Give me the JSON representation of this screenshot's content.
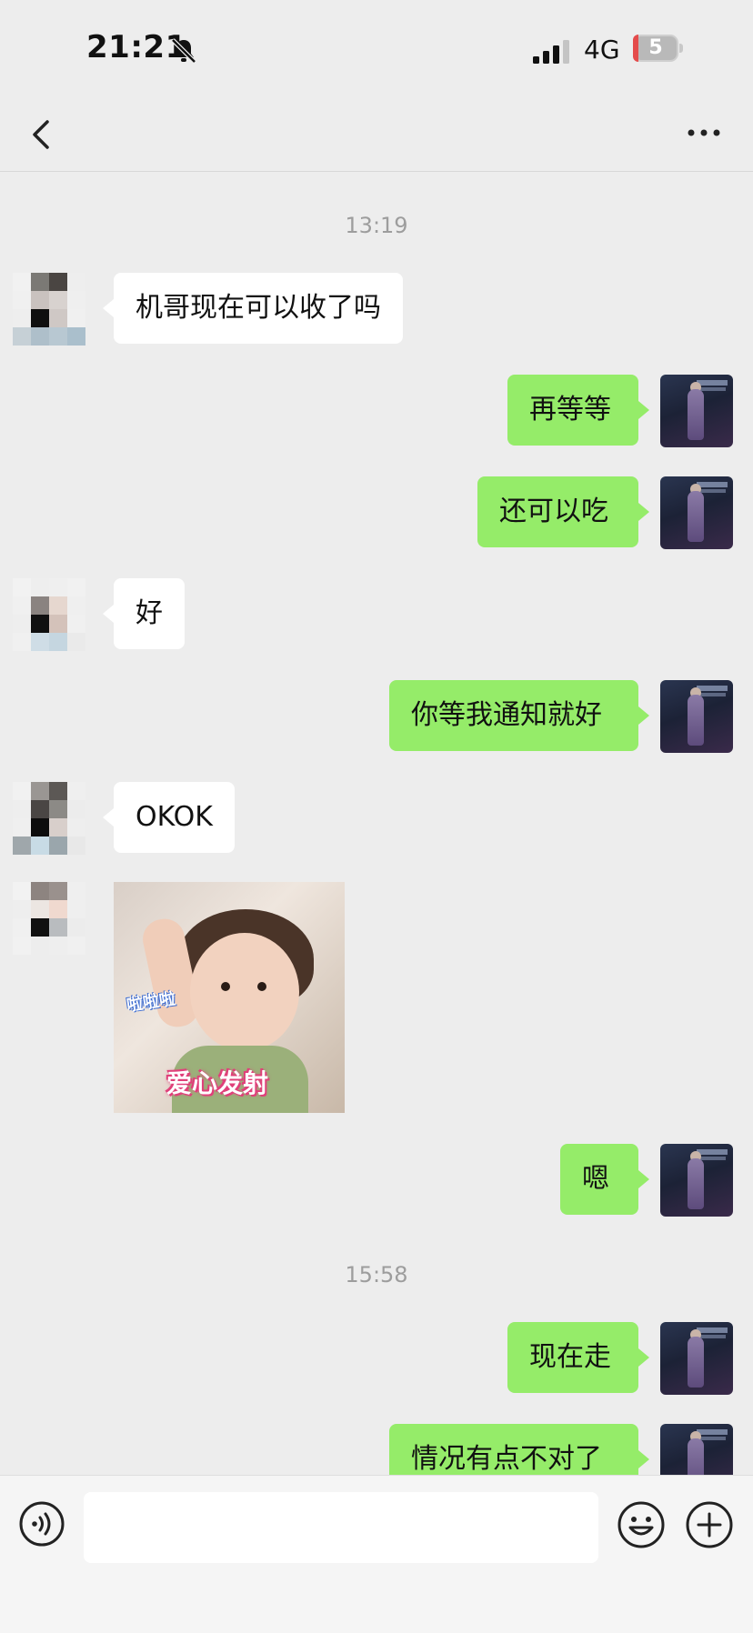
{
  "status_bar": {
    "time": "21:21",
    "network": "4G",
    "battery": "5"
  },
  "nav": {
    "title": ""
  },
  "timestamps": [
    "13:19",
    "15:58"
  ],
  "messages": [
    {
      "side": "in",
      "text": "机哥现在可以收了吗"
    },
    {
      "side": "out",
      "text": "再等等"
    },
    {
      "side": "out",
      "text": "还可以吃"
    },
    {
      "side": "in",
      "text": "好"
    },
    {
      "side": "out",
      "text": "你等我通知就好"
    },
    {
      "side": "in",
      "text": "OKOK"
    },
    {
      "side": "in",
      "type": "sticker",
      "caption": "爱心发射",
      "sub_caption": "啦啦啦"
    },
    {
      "side": "out",
      "text": "嗯"
    },
    {
      "side": "out",
      "text": "现在走"
    },
    {
      "side": "out",
      "text": "情况有点不对了"
    }
  ],
  "input": {
    "placeholder": ""
  },
  "colors": {
    "background": "#ededed",
    "outgoing_bubble": "#95ec69",
    "incoming_bubble": "#ffffff",
    "timestamp": "#9d9d9d"
  },
  "icons": [
    "bell-muted-icon",
    "signal-icon",
    "battery-icon",
    "back-icon",
    "more-icon",
    "voice-icon",
    "emoji-icon",
    "plus-icon"
  ]
}
